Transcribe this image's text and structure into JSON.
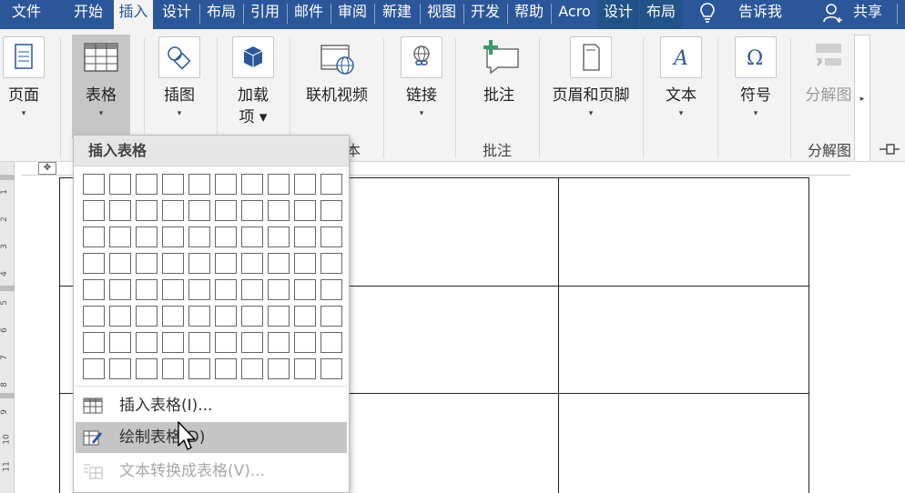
{
  "tabs": [
    {
      "label": "文件"
    },
    {
      "label": "开始"
    },
    {
      "label": "插入"
    },
    {
      "label": "设计"
    },
    {
      "label": "布局"
    },
    {
      "label": "引用"
    },
    {
      "label": "邮件"
    },
    {
      "label": "审阅"
    },
    {
      "label": "新建"
    },
    {
      "label": "视图"
    },
    {
      "label": "开发"
    },
    {
      "label": "帮助"
    },
    {
      "label": "Acro"
    },
    {
      "label": "设计"
    },
    {
      "label": "布局"
    }
  ],
  "tell_me": "告诉我",
  "share": "共享",
  "ribbon": {
    "page": {
      "label": "页面",
      "arrow": "▾"
    },
    "table": {
      "label": "表格",
      "arrow": "▾"
    },
    "illustrations": {
      "label": "插图",
      "arrow": "▾"
    },
    "addins": {
      "label_line1": "加载",
      "label_line2": "项 ▾"
    },
    "online_video": {
      "label": "联机视频"
    },
    "links": {
      "label": "链接",
      "arrow": "▾"
    },
    "comment": {
      "label": "批注"
    },
    "header_footer": {
      "label": "页眉和页脚",
      "arrow": "▾"
    },
    "text": {
      "label": "文本",
      "arrow": "▾"
    },
    "symbols": {
      "label": "符号",
      "arrow": "▾"
    },
    "split": {
      "label": "分解图"
    },
    "group_partial": "本",
    "group_comment": "批注",
    "group_split": "分解图"
  },
  "dropdown": {
    "header": "插入表格",
    "items": [
      {
        "label": "插入表格(I)..."
      },
      {
        "label": "绘制表格(D)"
      },
      {
        "label": "文本转换成表格(V)..."
      }
    ]
  },
  "ruler_numbers": [
    "1",
    "2",
    "3",
    "4",
    "5",
    "6",
    "7",
    "8",
    "9",
    "10",
    "11"
  ],
  "colors": {
    "accent": "#2b579a",
    "context_tab": "#215288",
    "ribbon_bg": "#f3f3f3",
    "highlight": "#c5c5c5"
  }
}
